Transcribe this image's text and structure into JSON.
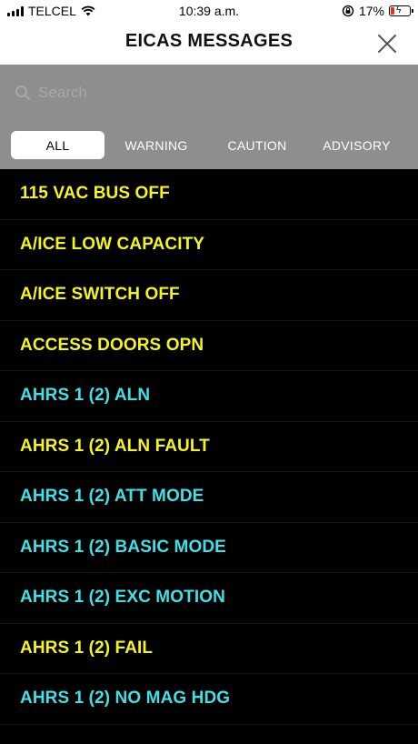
{
  "status_bar": {
    "carrier": "TELCEL",
    "time": "10:39 a.m.",
    "battery": "17%"
  },
  "nav": {
    "title": "EICAS MESSAGES"
  },
  "search": {
    "placeholder": "Search",
    "value": ""
  },
  "tabs": [
    {
      "label": "ALL",
      "active": true
    },
    {
      "label": "WARNING",
      "active": false
    },
    {
      "label": "CAUTION",
      "active": false
    },
    {
      "label": "ADVISORY",
      "active": false
    }
  ],
  "colors": {
    "caution": "#f5f51e",
    "advisory": "#3fe0e6",
    "battery_low": "#e0302a"
  },
  "messages": [
    {
      "text": "115 VAC BUS OFF",
      "type": "caution"
    },
    {
      "text": "A/ICE LOW CAPACITY",
      "type": "caution"
    },
    {
      "text": "A/ICE SWITCH OFF",
      "type": "caution"
    },
    {
      "text": "ACCESS DOORS OPN",
      "type": "caution"
    },
    {
      "text": "AHRS 1 (2) ALN",
      "type": "advisory"
    },
    {
      "text": "AHRS 1 (2) ALN FAULT",
      "type": "caution"
    },
    {
      "text": "AHRS 1 (2) ATT MODE",
      "type": "advisory"
    },
    {
      "text": "AHRS 1 (2) BASIC MODE",
      "type": "advisory"
    },
    {
      "text": "AHRS 1 (2) EXC MOTION",
      "type": "advisory"
    },
    {
      "text": "AHRS 1 (2) FAIL",
      "type": "caution"
    },
    {
      "text": "AHRS 1 (2) NO MAG HDG",
      "type": "advisory"
    }
  ]
}
